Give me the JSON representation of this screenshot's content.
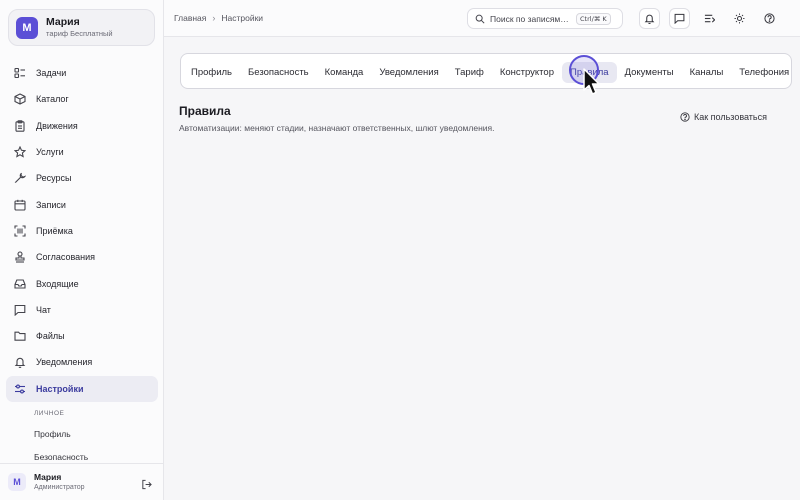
{
  "account": {
    "initial": "М",
    "name": "Мария",
    "plan": "тариф Бесплатный"
  },
  "sidebar": {
    "items": [
      {
        "label": "Задачи",
        "icon": "tasks-icon"
      },
      {
        "label": "Каталог",
        "icon": "box-icon"
      },
      {
        "label": "Движения",
        "icon": "clipboard-icon"
      },
      {
        "label": "Услуги",
        "icon": "star-icon"
      },
      {
        "label": "Ресурсы",
        "icon": "wrench-icon"
      },
      {
        "label": "Записи",
        "icon": "calendar-icon"
      },
      {
        "label": "Приёмка",
        "icon": "scan-icon"
      },
      {
        "label": "Согласования",
        "icon": "stamp-icon"
      },
      {
        "label": "Входящие",
        "icon": "inbox-icon"
      },
      {
        "label": "Чат",
        "icon": "chat-icon"
      },
      {
        "label": "Файлы",
        "icon": "folder-icon"
      },
      {
        "label": "Уведомления",
        "icon": "bell-icon"
      },
      {
        "label": "Настройки",
        "icon": "settings-sliders-icon",
        "active": true
      }
    ],
    "subsection": {
      "heading": "ЛИЧНОЕ",
      "items": [
        "Профиль",
        "Безопасность"
      ]
    }
  },
  "user": {
    "initial": "М",
    "name": "Мария",
    "role": "Администратор"
  },
  "breadcrumb": {
    "home": "Главная",
    "current": "Настройки"
  },
  "search": {
    "placeholder": "Поиск по записям…",
    "shortcut": "Ctrl/⌘ K"
  },
  "tabs": [
    {
      "label": "Профиль"
    },
    {
      "label": "Безопасность"
    },
    {
      "label": "Команда"
    },
    {
      "label": "Уведомления"
    },
    {
      "label": "Тариф"
    },
    {
      "label": "Конструктор"
    },
    {
      "label": "Правила",
      "active": true
    },
    {
      "label": "Документы"
    },
    {
      "label": "Каналы"
    },
    {
      "label": "Телефония"
    }
  ],
  "page": {
    "title": "Правила",
    "description": "Автоматизации: меняют стадии, назначают ответственных, шлют уведомления.",
    "help_label": "Как пользоваться"
  },
  "colors": {
    "accent": "#5b4fd6",
    "active_text": "#3b3b9e"
  }
}
